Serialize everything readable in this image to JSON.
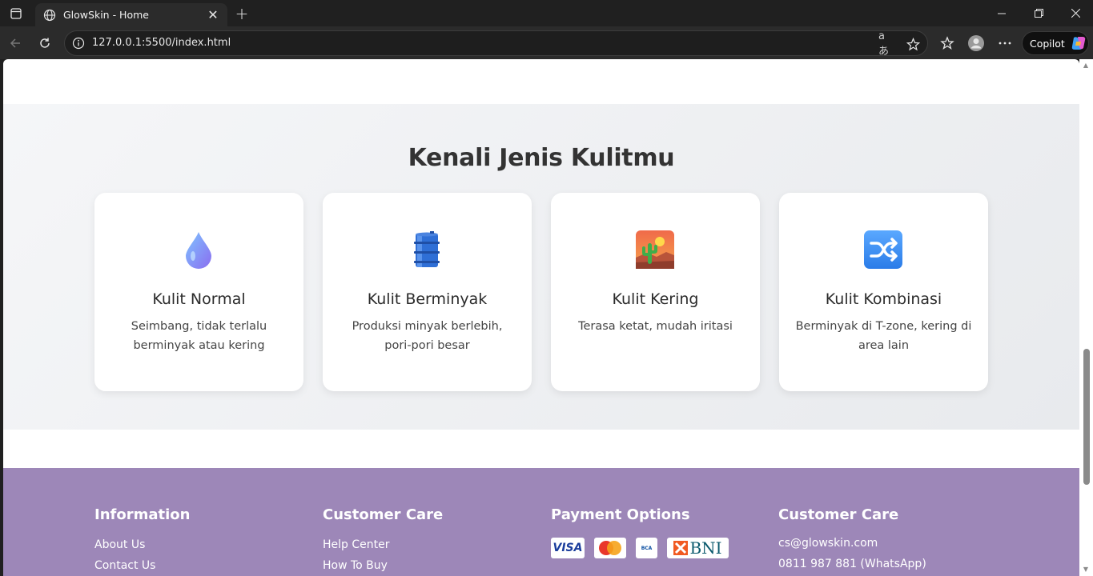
{
  "browser": {
    "tab_title": "GlowSkin - Home",
    "url": "127.0.0.1:5500/index.html",
    "copilot_label": "Copilot"
  },
  "skin_section": {
    "title": "Kenali Jenis Kulitmu",
    "cards": [
      {
        "title": "Kulit Normal",
        "desc": "Seimbang, tidak terlalu berminyak atau kering",
        "icon": "droplet-icon"
      },
      {
        "title": "Kulit Berminyak",
        "desc": "Produksi minyak berlebih, pori-pori besar",
        "icon": "oil-drum-icon"
      },
      {
        "title": "Kulit Kering",
        "desc": "Terasa ketat, mudah iritasi",
        "icon": "desert-icon"
      },
      {
        "title": "Kulit Kombinasi",
        "desc": "Berminyak di T-zone, kering di area lain",
        "icon": "shuffle-icon"
      }
    ]
  },
  "footer": {
    "information": {
      "title": "Information",
      "links": [
        "About Us",
        "Contact Us"
      ]
    },
    "customer_care": {
      "title": "Customer Care",
      "links": [
        "Help Center",
        "How To Buy"
      ]
    },
    "payment": {
      "title": "Payment Options",
      "methods": [
        "VISA",
        "MasterCard",
        "BCA",
        "BNI"
      ]
    },
    "contact": {
      "title": "Customer Care",
      "email": "cs@glowskin.com",
      "phone": "0811 987 881 (WhatsApp)"
    }
  },
  "colors": {
    "footer_bg": "#9d87b8",
    "section_bg": "#eef0f2",
    "card_bg": "#ffffff"
  }
}
